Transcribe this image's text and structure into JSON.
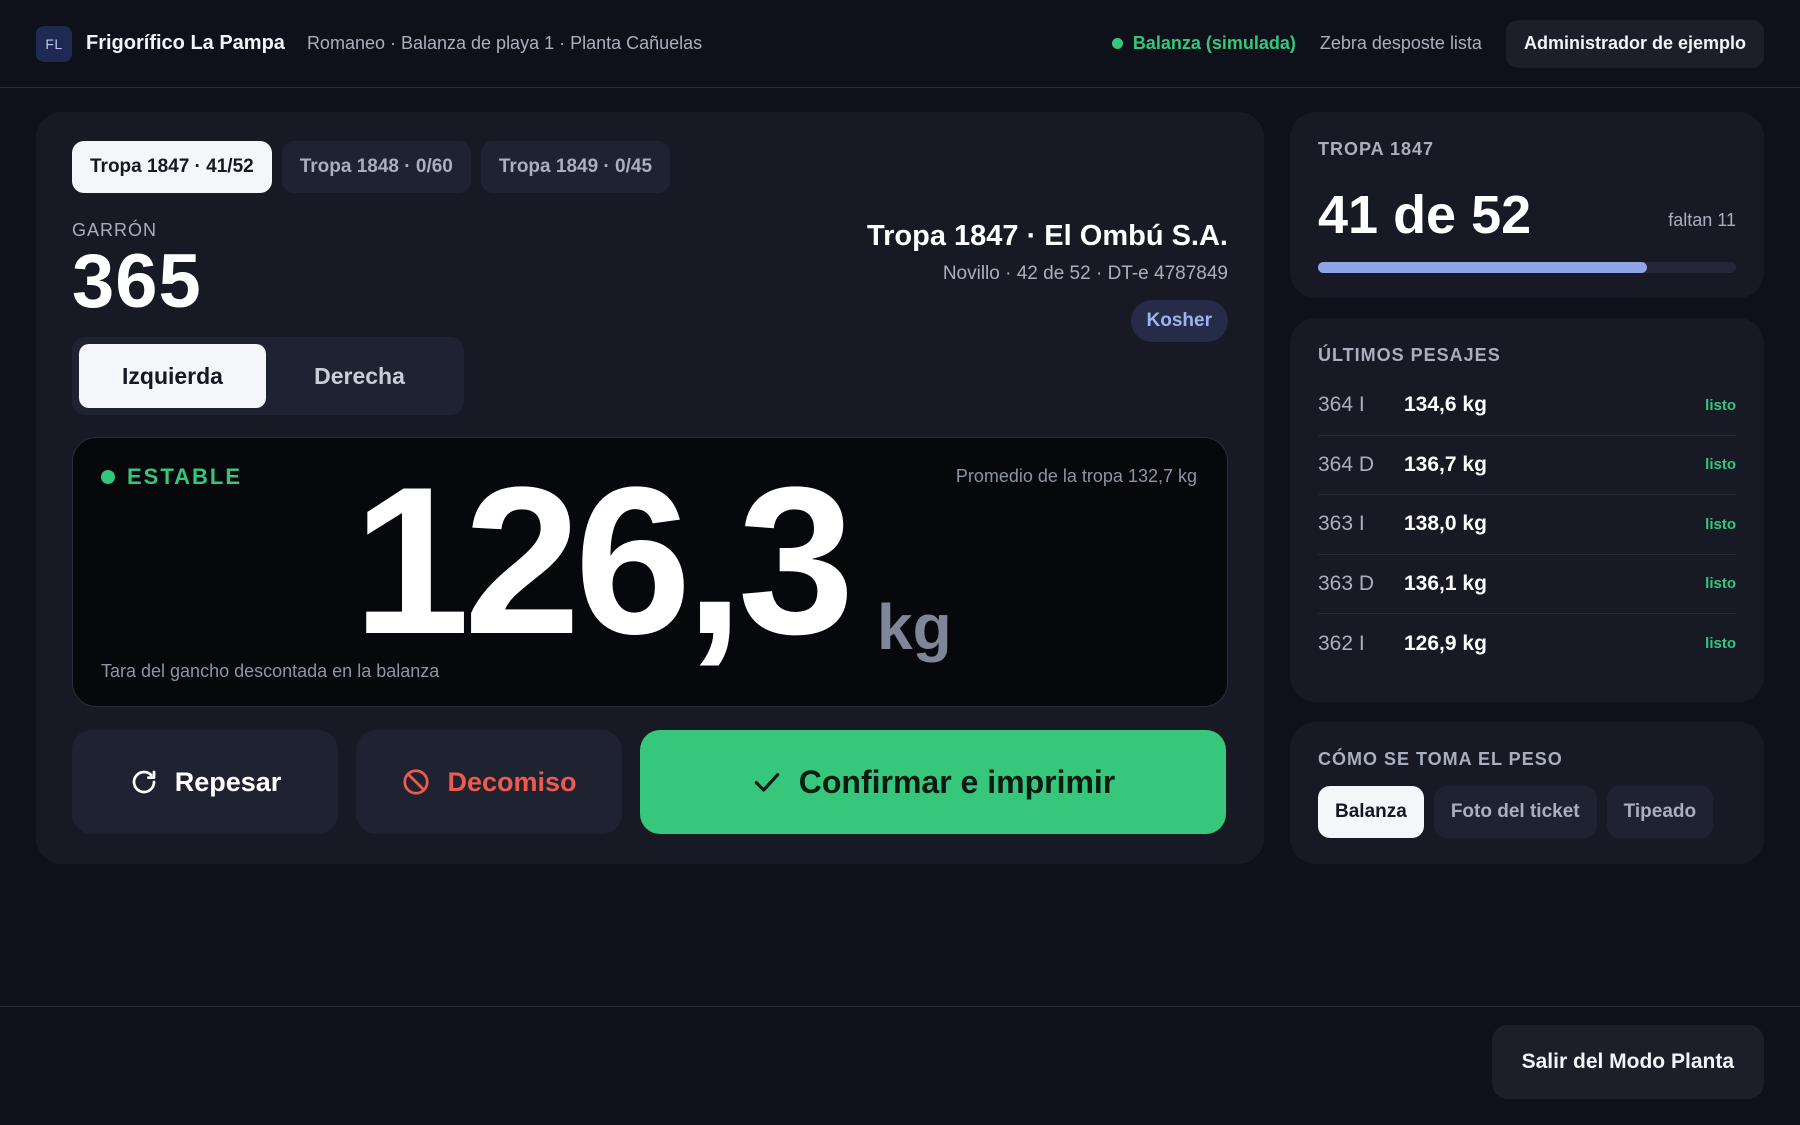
{
  "header": {
    "logo_text": "FL",
    "brand": "Frigorífico La Pampa",
    "subtitle": "Romaneo · Balanza de playa 1 · Planta Cañuelas",
    "scale_status": "Balanza (simulada)",
    "printer_status": "Zebra desposte lista",
    "user_label": "Administrador de ejemplo"
  },
  "tabs": [
    {
      "label": "Tropa 1847 · 41/52",
      "active": true
    },
    {
      "label": "Tropa 1848 · 0/60",
      "active": false
    },
    {
      "label": "Tropa 1849 · 0/45",
      "active": false
    }
  ],
  "garron": {
    "label": "GARRÓN",
    "number": "365"
  },
  "tropa": {
    "title": "Tropa 1847 · El Ombú S.A.",
    "subtitle": "Novillo · 42 de 52 · DT-e 4787849",
    "badge": "Kosher"
  },
  "side_toggle": {
    "left": "Izquierda",
    "right": "Derecha",
    "selected": "left"
  },
  "weight": {
    "status": "ESTABLE",
    "average": "Promedio de la tropa 132,7 kg",
    "value": "126,3",
    "unit": "kg",
    "tare_note": "Tara del gancho descontada en la balanza"
  },
  "actions": {
    "repesar": "Repesar",
    "decomiso": "Decomiso",
    "confirmar": "Confirmar e imprimir"
  },
  "progress": {
    "label": "TROPA 1847",
    "count": "41 de 52",
    "remaining": "faltan 11",
    "fraction": 0.788
  },
  "pesajes": {
    "label": "ÚLTIMOS PESAJES",
    "rows": [
      {
        "id": "364 I",
        "kg": "134,6 kg",
        "status": "listo"
      },
      {
        "id": "364 D",
        "kg": "136,7 kg",
        "status": "listo"
      },
      {
        "id": "363 I",
        "kg": "138,0 kg",
        "status": "listo"
      },
      {
        "id": "363 D",
        "kg": "136,1 kg",
        "status": "listo"
      },
      {
        "id": "362 I",
        "kg": "126,9 kg",
        "status": "listo"
      }
    ]
  },
  "peso_method": {
    "label": "CÓMO SE TOMA EL PESO",
    "options": [
      {
        "label": "Balanza",
        "active": true
      },
      {
        "label": "Foto del ticket",
        "active": false
      },
      {
        "label": "Tipeado",
        "active": false
      }
    ]
  },
  "footer": {
    "exit_label": "Salir del Modo Planta"
  },
  "colors": {
    "accent_green": "#36c77b",
    "danger": "#ef5a4f",
    "progress": "#8fa6e6",
    "badge": "#9fb2ef"
  }
}
